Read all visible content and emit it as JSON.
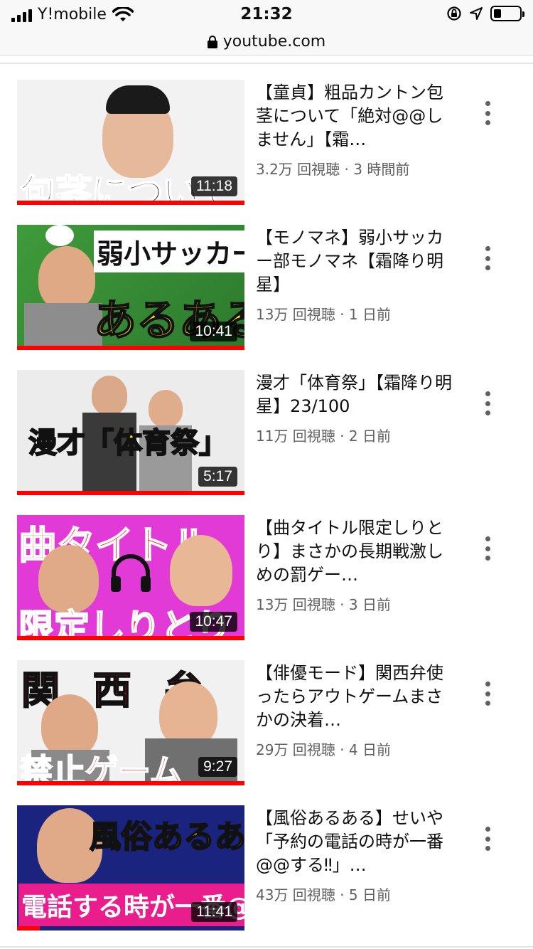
{
  "status_bar": {
    "carrier": "Y!mobile",
    "time": "21:32",
    "icons": [
      "signal-icon",
      "wifi-icon",
      "orientation-lock-icon",
      "location-icon",
      "battery-icon"
    ],
    "battery_level": 0.3
  },
  "url_bar": {
    "domain": "youtube.com"
  },
  "colors": {
    "progress": "#ff0000",
    "meta_text": "#606060",
    "title_text": "#0f0f0f"
  },
  "videos": [
    {
      "title": "【童貞】粗品カントン包茎について「絶対@@しません」【霜…",
      "views": "3.2万 回視聴",
      "age": "3 時間前",
      "duration": "11:18",
      "thumb_caption": "包茎について",
      "watched_fraction": 1.0
    },
    {
      "title": "【モノマネ】弱小サッカー部モノマネ【霜降り明星】",
      "views": "13万 回視聴",
      "age": "1 日前",
      "duration": "10:41",
      "thumb_caption": "弱小サッカー部",
      "thumb_caption_2": "あるある",
      "watched_fraction": 1.0
    },
    {
      "title": "漫才「体育祭」【霜降り明星】23/100",
      "views": "11万 回視聴",
      "age": "2 日前",
      "duration": "5:17",
      "thumb_caption": "漫才「体育祭」",
      "watched_fraction": 1.0
    },
    {
      "title": "【曲タイトル限定しりとり】まさかの長期戦激しめの罰ゲー…",
      "views": "13万 回視聴",
      "age": "3 日前",
      "duration": "10:47",
      "thumb_caption": "曲タイトル",
      "thumb_caption_2": "限定しりとり",
      "watched_fraction": 1.0
    },
    {
      "title": "【俳優モード】関西弁使ったらアウトゲームまさかの決着…",
      "views": "29万 回視聴",
      "age": "4 日前",
      "duration": "9:27",
      "thumb_caption": "関 西 弁",
      "thumb_caption_2": "禁止ゲーム",
      "watched_fraction": 1.0
    },
    {
      "title": "【風俗あるある】せいや「予約の電話の時が一番@@する‼」…",
      "views": "43万 回視聴",
      "age": "5 日前",
      "duration": "11:41",
      "thumb_caption": "風俗あるある",
      "thumb_caption_2": "電話する時が一番@@",
      "watched_fraction": 0.1
    }
  ]
}
